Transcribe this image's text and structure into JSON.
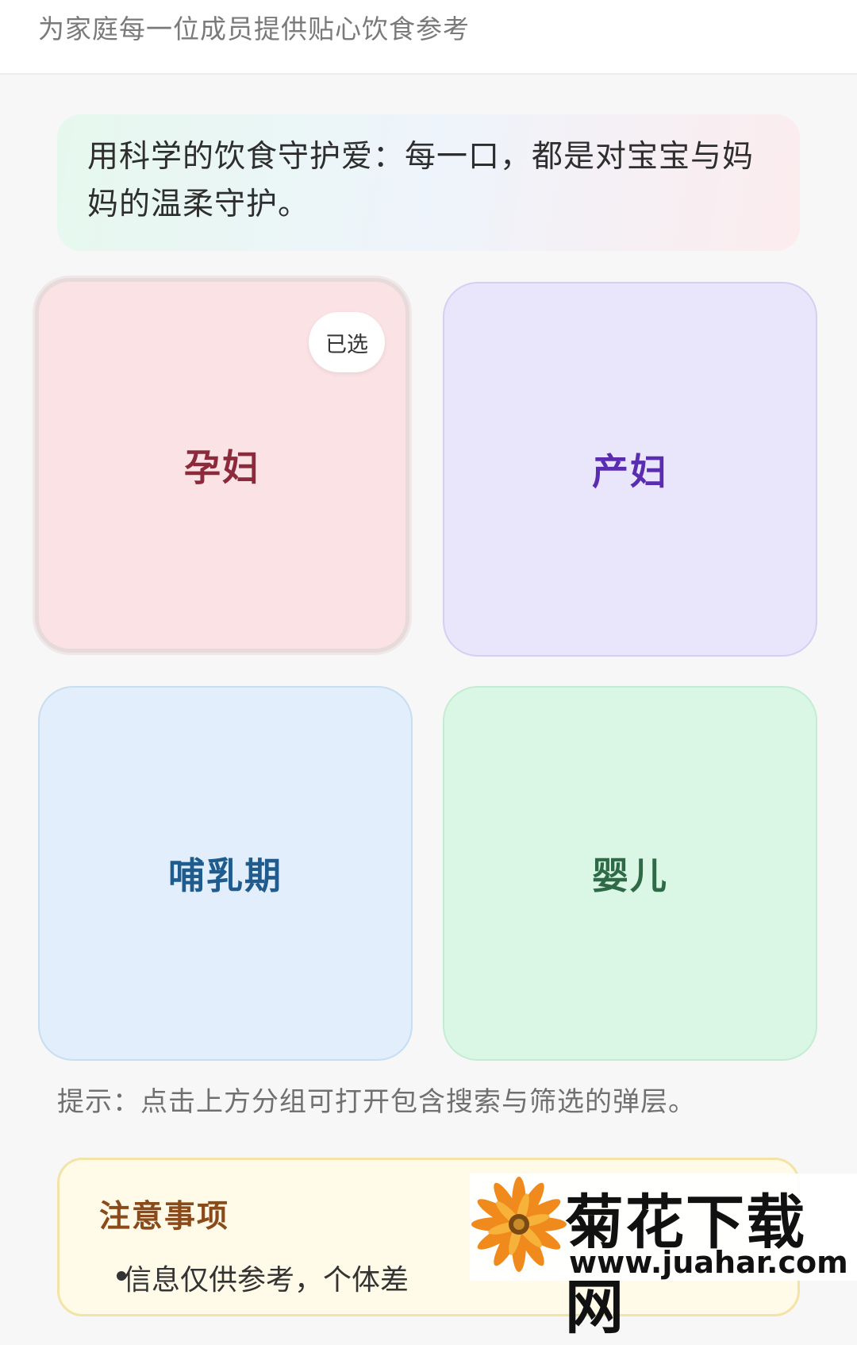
{
  "header": {
    "subtitle": "为家庭每一位成员提供贴心饮食参考"
  },
  "banner": {
    "text": "用科学的饮食守护爱：每一口，都是对宝宝与妈妈的温柔守护。"
  },
  "groups": [
    {
      "label": "孕妇",
      "selected": true,
      "badge": "已选",
      "color": "#8c2a3c",
      "bg": "#fbe3e5"
    },
    {
      "label": "产妇",
      "selected": false,
      "color": "#5a2db0",
      "bg": "#e9e5fb"
    },
    {
      "label": "哺乳期",
      "selected": false,
      "color": "#1f5b8c",
      "bg": "#e2eefb"
    },
    {
      "label": "婴儿",
      "selected": false,
      "color": "#2e6a46",
      "bg": "#daf7e6"
    }
  ],
  "hint": "提示：点击上方分组可打开包含搜索与筛选的弹层。",
  "notice": {
    "title": "注意事项",
    "items": [
      "信息仅供参考，个体差"
    ]
  },
  "watermark": {
    "title": "菊花下载网",
    "url": "www.juahar.com",
    "icon": "flower-icon"
  }
}
